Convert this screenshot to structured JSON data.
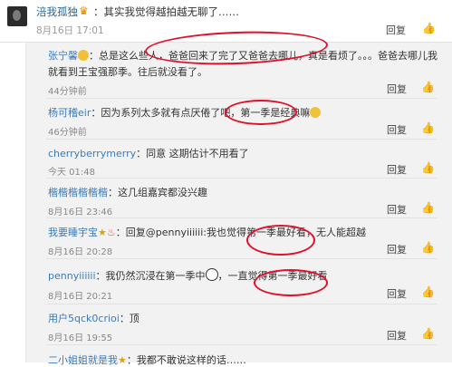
{
  "top": {
    "user": "涪我孤独",
    "badge": "♛",
    "text": "：其实我觉得越拍越无聊了……",
    "time": "8月16日 17:01",
    "reply": "回复",
    "like": "👍"
  },
  "comments": [
    {
      "user": "张宁馨",
      "line1": "：总是这么些人，爸爸回来了完了又爸爸去哪儿，真是看烦了。。。爸爸去哪儿我",
      "line2": "就看到王宝强那季。往后就没看了。",
      "time": "44分钟前",
      "reply": "回复",
      "like": "👍"
    },
    {
      "user": "杨可稽eir",
      "line1": "：因为系列太多就有点厌倦了吧，第一季是经典嘛",
      "time": "46分钟前",
      "reply": "回复",
      "like": "👍"
    },
    {
      "user": "cherryberrymerry",
      "line1": "：同意 这期估计不用看了",
      "time": "今天 01:48",
      "reply": "回复",
      "like": "👍"
    },
    {
      "user": "楷楷楷楷楷楷",
      "line1": "：这几组嘉宾都没兴趣",
      "time": "8月16日 23:46",
      "reply": "回复",
      "like": "👍"
    },
    {
      "user": "我要睡宇宝",
      "line1": "：回复@pennyiiiiii:我也觉得第一季最好看，无人能超越",
      "time": "8月16日 20:28",
      "reply": "回复",
      "like": "👍"
    },
    {
      "user": "pennyiiiiii",
      "line1": "：我仍然沉浸在第一季中",
      "line1b": "，一直觉得第一季最好看",
      "time": "8月16日 20:21",
      "reply": "回复",
      "like": "👍"
    },
    {
      "user": "用户5qck0crioi",
      "line1": "：顶",
      "time": "8月16日 19:55",
      "reply": "回复",
      "like": "👍"
    },
    {
      "user": "二小姐姐就是我",
      "line1": "：我都不敢说这样的话……"
    }
  ]
}
